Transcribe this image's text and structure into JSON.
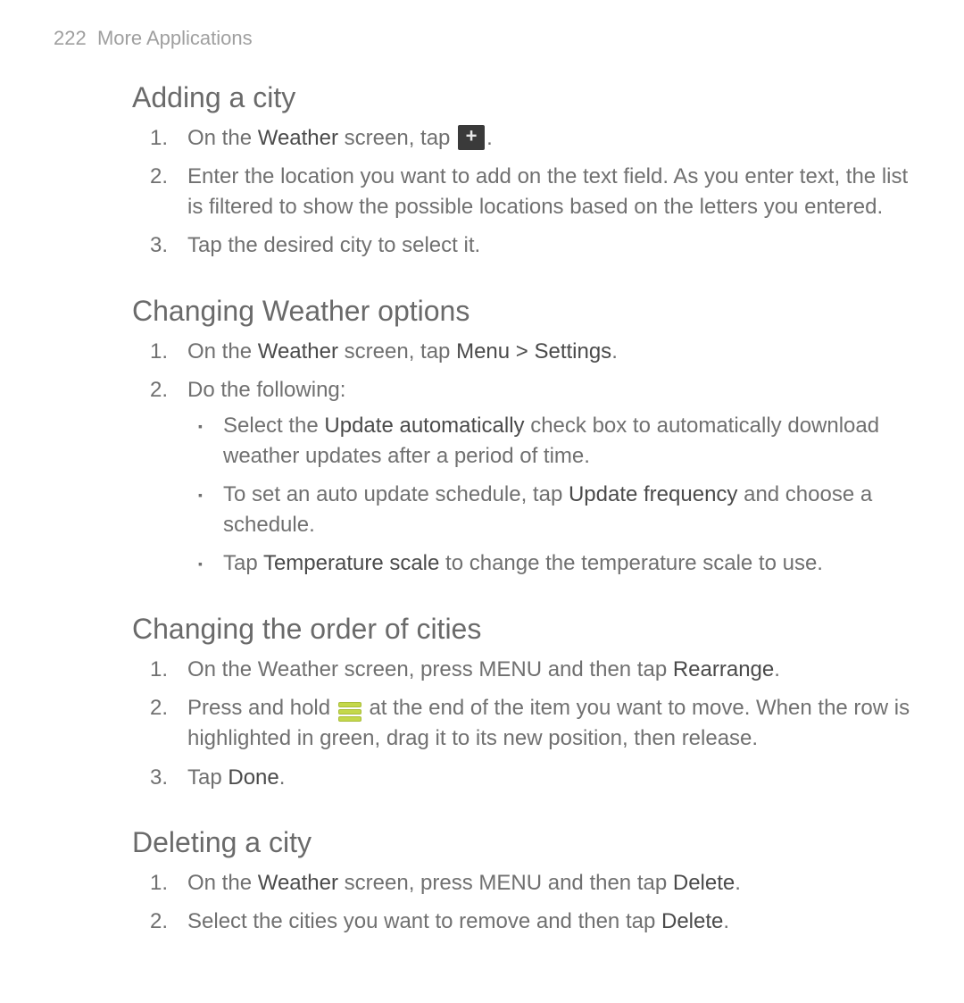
{
  "header": {
    "page_number": "222",
    "chapter": "More Applications"
  },
  "sections": {
    "add_city": {
      "title": "Adding a city",
      "step1_a": "On the ",
      "step1_b": "Weather",
      "step1_c": " screen, tap ",
      "step1_d": ".",
      "step2": "Enter the location you want to add on the text field. As you enter text, the list is filtered to show the possible locations based on the letters you entered.",
      "step3": "Tap the desired city to select it."
    },
    "change_options": {
      "title": "Changing Weather options",
      "step1_a": "On the ",
      "step1_b": "Weather",
      "step1_c": " screen, tap ",
      "step1_d": "Menu > Settings",
      "step1_e": ".",
      "step2": "Do the following:",
      "b1_a": "Select the ",
      "b1_b": "Update automatically",
      "b1_c": " check box to automatically download weather updates after a period of time.",
      "b2_a": "To set an auto update schedule, tap ",
      "b2_b": "Update frequency",
      "b2_c": " and choose a schedule.",
      "b3_a": "Tap ",
      "b3_b": "Temperature scale",
      "b3_c": " to change the temperature scale to use."
    },
    "change_order": {
      "title": "Changing the order of cities",
      "step1_a": "On the Weather screen, press MENU and then tap ",
      "step1_b": "Rearrange",
      "step1_c": ".",
      "step2_a": "Press and hold ",
      "step2_b": " at the end of the item you want to move. When the row is highlighted in green, drag it to its new position, then release.",
      "step3_a": "Tap ",
      "step3_b": "Done",
      "step3_c": "."
    },
    "delete_city": {
      "title": "Deleting a city",
      "step1_a": "On the ",
      "step1_b": "Weather",
      "step1_c": " screen, press MENU and then tap ",
      "step1_d": "Delete",
      "step1_e": ".",
      "step2_a": "Select the cities you want to remove and then tap ",
      "step2_b": "Delete",
      "step2_c": "."
    }
  },
  "nums": {
    "n1": "1.",
    "n2": "2.",
    "n3": "3."
  }
}
